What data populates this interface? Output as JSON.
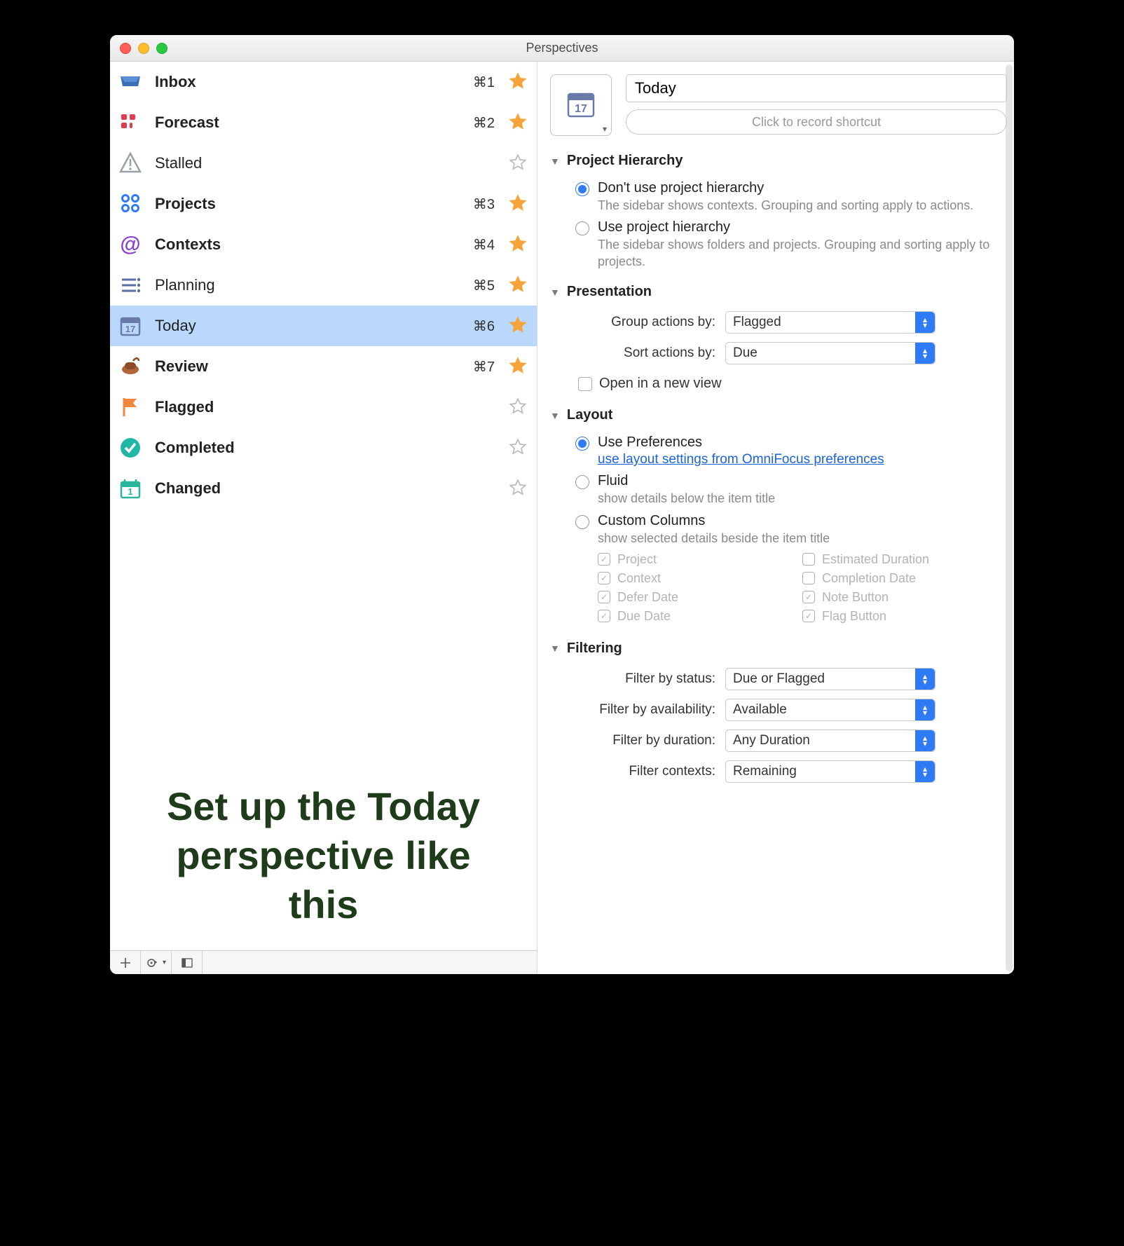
{
  "window": {
    "title": "Perspectives"
  },
  "sidebar": {
    "items": [
      {
        "icon": "inbox",
        "label": "Inbox",
        "shortcut": "⌘1",
        "starred": true,
        "bold": true
      },
      {
        "icon": "forecast",
        "label": "Forecast",
        "shortcut": "⌘2",
        "starred": true,
        "bold": true
      },
      {
        "icon": "stalled",
        "label": "Stalled",
        "shortcut": "",
        "starred": false,
        "bold": false
      },
      {
        "icon": "projects",
        "label": "Projects",
        "shortcut": "⌘3",
        "starred": true,
        "bold": true
      },
      {
        "icon": "contexts",
        "label": "Contexts",
        "shortcut": "⌘4",
        "starred": true,
        "bold": true
      },
      {
        "icon": "planning",
        "label": "Planning",
        "shortcut": "⌘5",
        "starred": true,
        "bold": false
      },
      {
        "icon": "today",
        "label": "Today",
        "shortcut": "⌘6",
        "starred": true,
        "bold": false,
        "selected": true
      },
      {
        "icon": "review",
        "label": "Review",
        "shortcut": "⌘7",
        "starred": true,
        "bold": true
      },
      {
        "icon": "flagged",
        "label": "Flagged",
        "shortcut": "",
        "starred": false,
        "bold": true
      },
      {
        "icon": "completed",
        "label": "Completed",
        "shortcut": "",
        "starred": false,
        "bold": true
      },
      {
        "icon": "changed",
        "label": "Changed",
        "shortcut": "",
        "starred": false,
        "bold": true
      }
    ],
    "overlay": "Set up the Today perspective like this"
  },
  "toolbar": {
    "add": "+",
    "gear": "✻",
    "collapse": "◧"
  },
  "editor": {
    "name": "Today",
    "shortcut_placeholder": "Click to record shortcut",
    "sections": {
      "hierarchy": {
        "title": "Project Hierarchy",
        "options": [
          {
            "label": "Don't use project hierarchy",
            "desc": "The sidebar shows contexts. Grouping and sorting apply to actions.",
            "checked": true
          },
          {
            "label": "Use project hierarchy",
            "desc": "The sidebar shows folders and projects. Grouping and sorting apply to projects.",
            "checked": false
          }
        ]
      },
      "presentation": {
        "title": "Presentation",
        "group_label": "Group actions by:",
        "group_value": "Flagged",
        "sort_label": "Sort actions by:",
        "sort_value": "Due",
        "open_new_label": "Open in a new view",
        "open_new_checked": false
      },
      "layout": {
        "title": "Layout",
        "options": [
          {
            "label": "Use Preferences",
            "link": "use layout settings from OmniFocus preferences",
            "checked": true
          },
          {
            "label": "Fluid",
            "desc": "show details below the item title",
            "checked": false
          },
          {
            "label": "Custom Columns",
            "desc": "show selected details beside the item title",
            "checked": false
          }
        ],
        "columns": [
          {
            "label": "Project",
            "checked": true
          },
          {
            "label": "Estimated Duration",
            "checked": false
          },
          {
            "label": "Context",
            "checked": true
          },
          {
            "label": "Completion Date",
            "checked": false
          },
          {
            "label": "Defer Date",
            "checked": true
          },
          {
            "label": "Note Button",
            "checked": true
          },
          {
            "label": "Due Date",
            "checked": true
          },
          {
            "label": "Flag Button",
            "checked": true
          }
        ]
      },
      "filtering": {
        "title": "Filtering",
        "rows": [
          {
            "label": "Filter by status:",
            "value": "Due or Flagged"
          },
          {
            "label": "Filter by availability:",
            "value": "Available"
          },
          {
            "label": "Filter by duration:",
            "value": "Any Duration"
          },
          {
            "label": "Filter contexts:",
            "value": "Remaining"
          }
        ]
      }
    }
  }
}
